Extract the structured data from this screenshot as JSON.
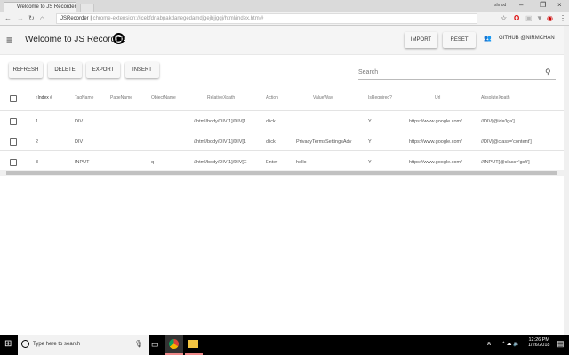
{
  "browser": {
    "tab_title": "Welcome to JS Recorder",
    "user": "slmod",
    "site_label": "JSRecorder",
    "url": "chrome-extension://jcekfdnabpakdanegedamdjgejbjjggj/html/index.html#"
  },
  "header": {
    "title": "Welcome to JS Recorder!",
    "import_label": "IMPORT",
    "reset_label": "RESET",
    "github_label": "GITHUB @NIRMCHAN"
  },
  "toolbar": {
    "refresh_label": "REFRESH",
    "delete_label": "DELETE",
    "export_label": "EXPORT",
    "insert_label": "INSERT",
    "search_placeholder": "Search"
  },
  "table": {
    "columns": [
      "Index #",
      "TagName",
      "PageName",
      "ObjectName",
      "RelativeXpath",
      "Action",
      "ValueWay",
      "IsRequired?",
      "Url",
      "AbsoluteXpath"
    ],
    "sort_indicator": "↑",
    "rows": [
      {
        "index": "1",
        "tag": "DIV",
        "page": "",
        "object": "",
        "rel": "//html/body/DIV[1]/DIV[1",
        "action": "click",
        "value": "",
        "req": "Y",
        "url": "https://www.google.com/",
        "abs": "//DIV[@id='lga']"
      },
      {
        "index": "2",
        "tag": "DIV",
        "page": "",
        "object": "",
        "rel": "//html/body/DIV[1]/DIV[1",
        "action": "click",
        "value": "PrivacyTermsSettingsAdv",
        "req": "Y",
        "url": "https://www.google.com/",
        "abs": "//DIV[@class='content']"
      },
      {
        "index": "3",
        "tag": "INPUT",
        "page": "",
        "object": "q",
        "rel": "//html/body/DIV[1]/DIV[E",
        "action": "Enter",
        "value": "hello",
        "req": "Y",
        "url": "https://www.google.com/",
        "abs": "//INPUT[@class='gsfi']"
      }
    ]
  },
  "taskbar": {
    "search_placeholder": "Type here to search",
    "time": "12:26 PM",
    "date": "1/26/2018"
  }
}
